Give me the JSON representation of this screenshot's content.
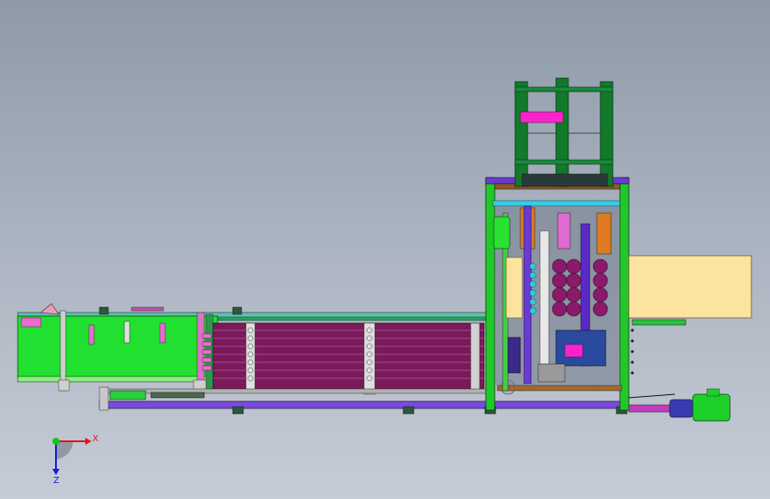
{
  "view": {
    "background_top": "#8e9aa8",
    "background_bottom": "#c6ccd6"
  },
  "colors": {
    "frame_green": "#22c82a",
    "light_green": "#4ef04a",
    "dark_green": "#127a2a",
    "purple_rollers": "#7a1a5a",
    "magenta": "#ff22cc",
    "blue_purple": "#6a3ad6",
    "cyan": "#30d0e8",
    "beige_panel": "#fce3a0",
    "orange": "#e07a20",
    "brown": "#8a5a2a",
    "motor_green": "#1ed02a"
  },
  "triad": {
    "x_label": "X",
    "z_label": "Z",
    "x_color": "#e01818",
    "y_color": "#18c018",
    "z_color": "#1818e0"
  }
}
